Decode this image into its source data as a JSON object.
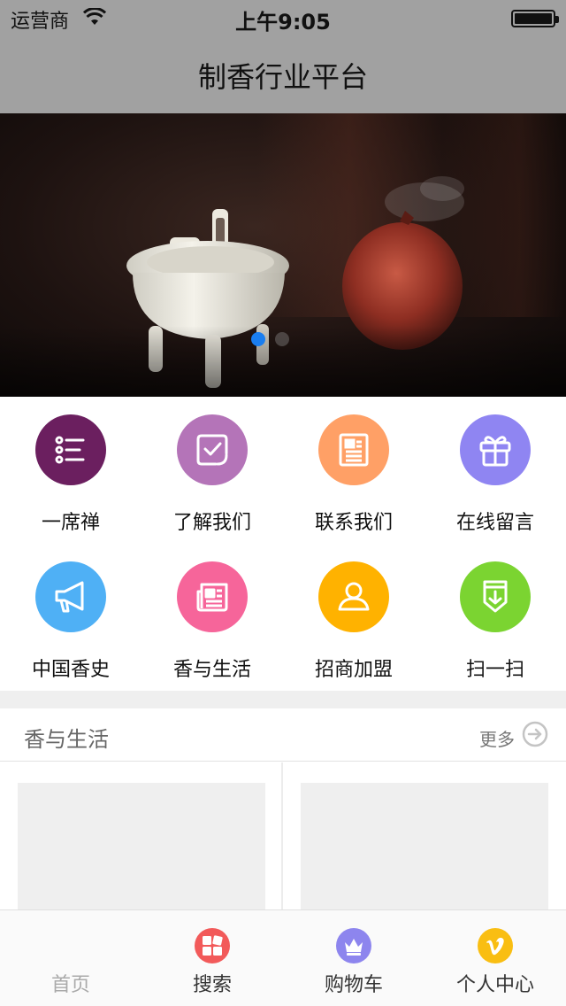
{
  "status_bar": {
    "carrier": "运营商",
    "time": "上午9:05"
  },
  "nav": {
    "title": "制香行业平台"
  },
  "banner": {
    "slides_shown": 2,
    "active_index": 0
  },
  "menu": [
    {
      "label": "一席禅",
      "icon": "list-icon",
      "color": "#6b1f5f"
    },
    {
      "label": "了解我们",
      "icon": "checkbox-icon",
      "color": "#b474b8"
    },
    {
      "label": "联系我们",
      "icon": "document-icon",
      "color": "#ffa066"
    },
    {
      "label": "在线留言",
      "icon": "gift-icon",
      "color": "#8f85f2"
    },
    {
      "label": "中国香史",
      "icon": "megaphone-icon",
      "color": "#4fb0f5"
    },
    {
      "label": "香与生活",
      "icon": "newspaper-icon",
      "color": "#f6659a"
    },
    {
      "label": "招商加盟",
      "icon": "user-icon",
      "color": "#ffb200"
    },
    {
      "label": "扫一扫",
      "icon": "bookmark-icon",
      "color": "#7bd431"
    }
  ],
  "section": {
    "title": "香与生活",
    "more_label": "更多"
  },
  "tabs": [
    {
      "label": "首页",
      "icon": "",
      "color": ""
    },
    {
      "label": "搜索",
      "icon": "grid-icon",
      "color": "#f25a5a"
    },
    {
      "label": "购物车",
      "icon": "crown-icon",
      "color": "#8d85ee"
    },
    {
      "label": "个人中心",
      "icon": "vimeo-icon",
      "color": "#f9be12"
    }
  ]
}
